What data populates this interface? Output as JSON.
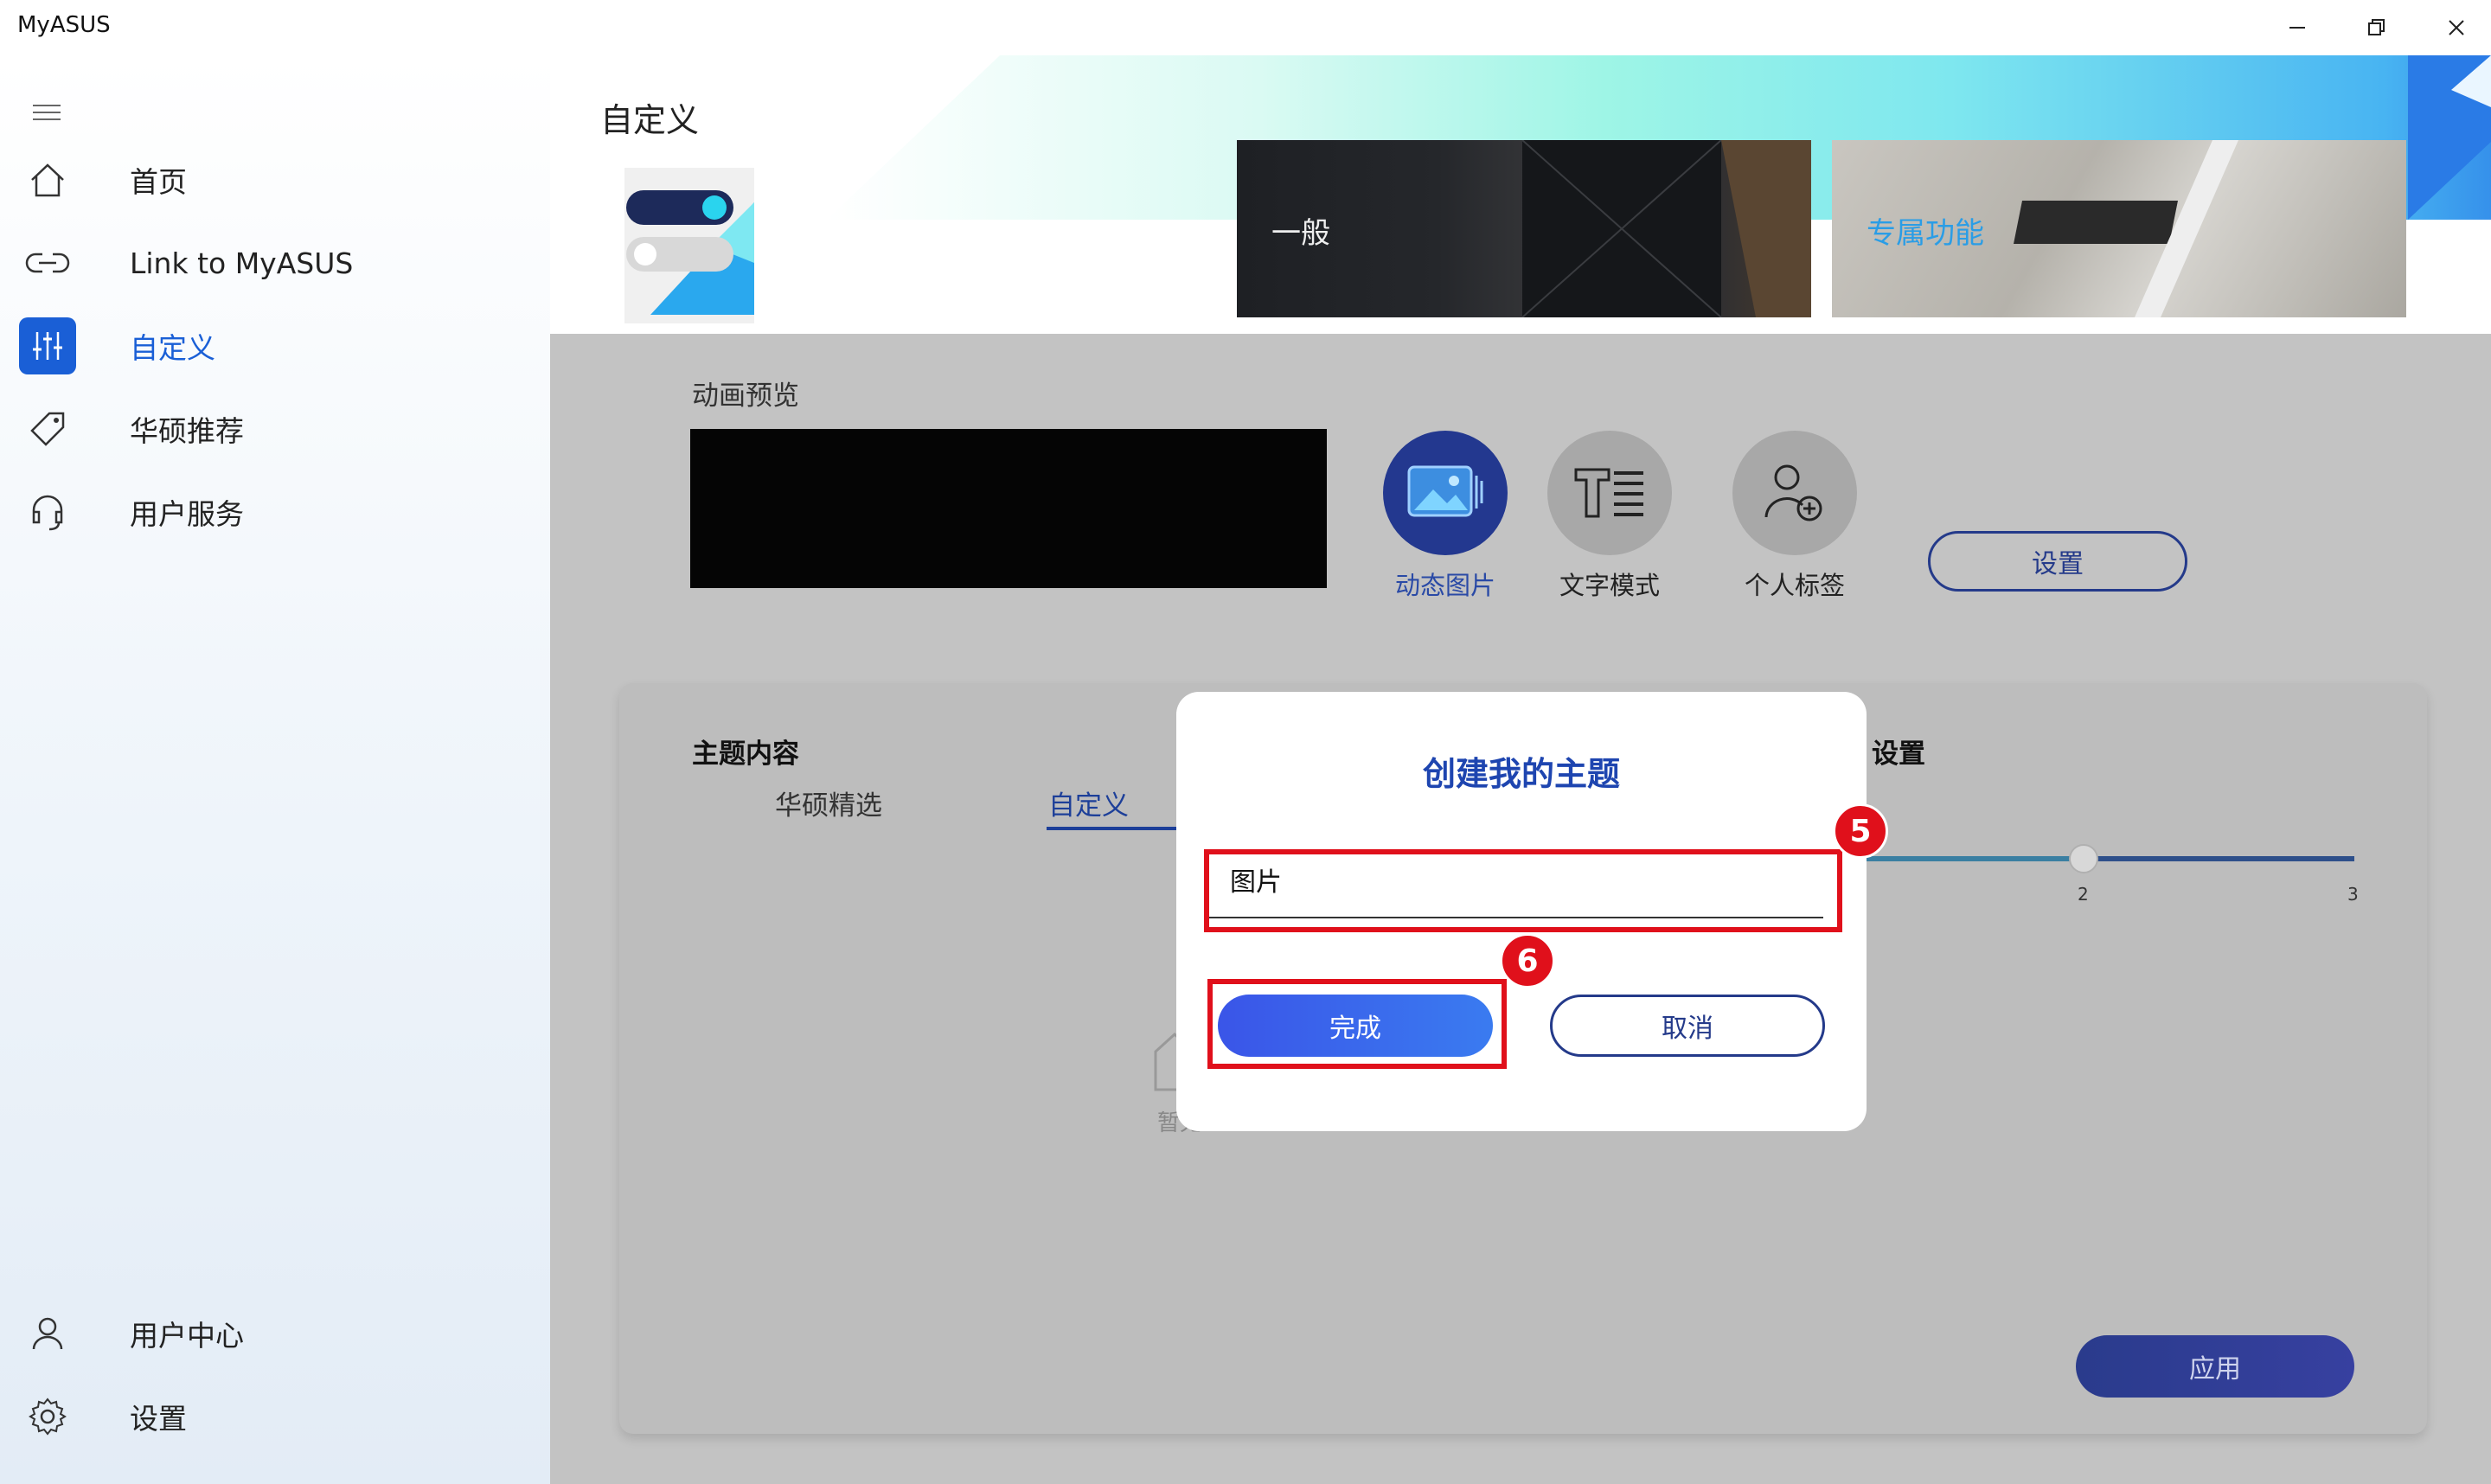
{
  "window": {
    "title": "MyASUS",
    "controls": [
      "minimize-icon",
      "restore-icon",
      "close-icon"
    ]
  },
  "sidebar": {
    "menu_icon": "hamburger-icon",
    "items": [
      {
        "label": "首页",
        "icon": "home-icon",
        "active": false
      },
      {
        "label": "Link to MyASUS",
        "icon": "link-icon",
        "active": false
      },
      {
        "label": "自定义",
        "icon": "sliders-icon",
        "active": true
      },
      {
        "label": "华硕推荐",
        "icon": "tag-icon",
        "active": false
      },
      {
        "label": "用户服务",
        "icon": "headset-icon",
        "active": false
      }
    ],
    "bottom_items": [
      {
        "label": "用户中心",
        "icon": "user-icon"
      },
      {
        "label": "设置",
        "icon": "gear-icon"
      }
    ]
  },
  "header": {
    "title": "自定义",
    "cards": [
      {
        "label": "一般"
      },
      {
        "label": "专属功能"
      }
    ]
  },
  "preview": {
    "label": "动画预览",
    "modes": [
      {
        "label": "动态图片",
        "icon": "image-icon",
        "selected": true
      },
      {
        "label": "文字模式",
        "icon": "text-mode-icon",
        "selected": false
      },
      {
        "label": "个人标签",
        "icon": "person-tag-icon",
        "selected": false
      }
    ],
    "settings_button": "设置"
  },
  "theme_panel": {
    "title": "主题内容",
    "tabs": [
      {
        "label": "华硕精选",
        "active": false
      },
      {
        "label": "自定义",
        "active": true
      }
    ],
    "right_title": "设置",
    "slider": {
      "value": 2,
      "ticks": [
        "2",
        "3"
      ]
    },
    "empty_text": "暂无…",
    "apply_button": "应用"
  },
  "dialog": {
    "title": "创建我的主题",
    "input_value": "图片",
    "confirm_button": "完成",
    "cancel_button": "取消"
  },
  "annotations": {
    "steps": [
      "5",
      "6"
    ],
    "highlight_color": "#e0101b"
  },
  "colors": {
    "accent": "#1a5fd6",
    "dialog_title": "#1e45b0",
    "button_gradient_start": "#3a55e8",
    "outline_button": "#243a8a"
  }
}
